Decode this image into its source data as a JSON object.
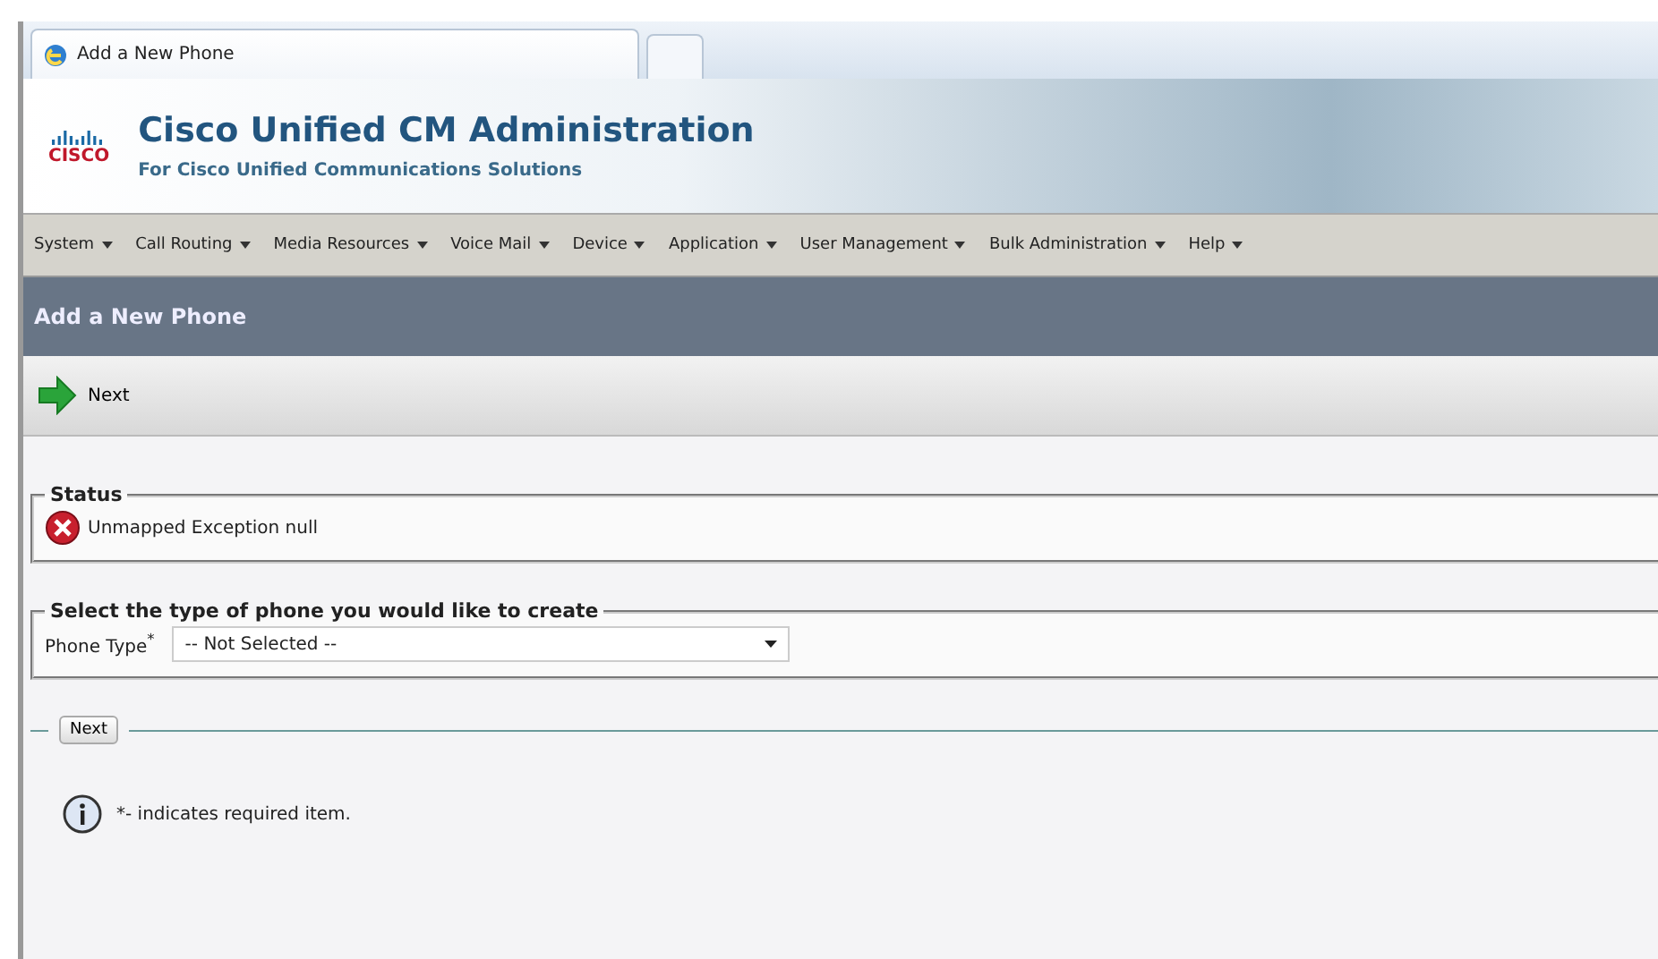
{
  "browser_tab": {
    "title": "Add a New Phone"
  },
  "header": {
    "logo": "CISCO",
    "title": "Cisco Unified CM Administration",
    "subtitle": "For Cisco Unified Communications Solutions"
  },
  "menu": [
    {
      "label": "System"
    },
    {
      "label": "Call Routing"
    },
    {
      "label": "Media Resources"
    },
    {
      "label": "Voice Mail"
    },
    {
      "label": "Device"
    },
    {
      "label": "Application"
    },
    {
      "label": "User Management"
    },
    {
      "label": "Bulk Administration"
    },
    {
      "label": "Help"
    }
  ],
  "page_title": "Add a New Phone",
  "toolbar": {
    "button": "Next"
  },
  "status": {
    "legend": "Status",
    "message": "Unmapped Exception null"
  },
  "phone_type": {
    "legend": "Select the type of phone you would like to create",
    "label": "Phone Type$^{*}$",
    "value": "-- Not Selected --"
  },
  "next_button": "Next",
  "note": "*- indicates required item."
}
